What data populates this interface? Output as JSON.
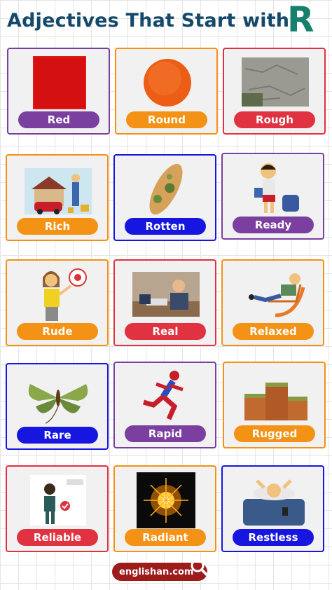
{
  "header": {
    "title": "Adjectives That Start with",
    "letter": "R"
  },
  "colors": {
    "purple": "#7b3fa0",
    "orange": "#f39214",
    "red": "#e03240",
    "blue": "#1616e0",
    "title": "#15496b",
    "letter": "#17806d"
  },
  "cards": [
    {
      "label": "Red",
      "border": "purple",
      "pill": "purple",
      "icon": "red-square-icon"
    },
    {
      "label": "Round",
      "border": "orange",
      "pill": "orange",
      "icon": "orange-circle-icon"
    },
    {
      "label": "Rough",
      "border": "red",
      "pill": "red",
      "icon": "rough-wall-icon"
    },
    {
      "label": "Rich",
      "border": "orange",
      "pill": "orange",
      "icon": "rich-man-icon"
    },
    {
      "label": "Rotten",
      "border": "blue",
      "pill": "blue",
      "icon": "rotten-bread-icon"
    },
    {
      "label": "Ready",
      "border": "purple",
      "pill": "purple",
      "icon": "ready-student-icon"
    },
    {
      "label": "Rude",
      "border": "orange",
      "pill": "orange",
      "icon": "rude-woman-icon"
    },
    {
      "label": "Real",
      "border": "red",
      "pill": "red",
      "icon": "real-deal-icon"
    },
    {
      "label": "Relaxed",
      "border": "orange",
      "pill": "orange",
      "icon": "relaxed-man-icon"
    },
    {
      "label": "Rare",
      "border": "blue",
      "pill": "blue",
      "icon": "rare-moth-icon"
    },
    {
      "label": "Rapid",
      "border": "purple",
      "pill": "purple",
      "icon": "rapid-runner-icon"
    },
    {
      "label": "Rugged",
      "border": "orange",
      "pill": "orange",
      "icon": "rugged-rock-icon"
    },
    {
      "label": "Reliable",
      "border": "red",
      "pill": "red",
      "icon": "reliable-worker-icon"
    },
    {
      "label": "Radiant",
      "border": "orange",
      "pill": "orange",
      "icon": "radiant-light-icon"
    },
    {
      "label": "Restless",
      "border": "blue",
      "pill": "blue",
      "icon": "restless-sleeper-icon"
    }
  ],
  "footer": {
    "site": "englishan.com",
    "icon": "magnifier-icon"
  }
}
